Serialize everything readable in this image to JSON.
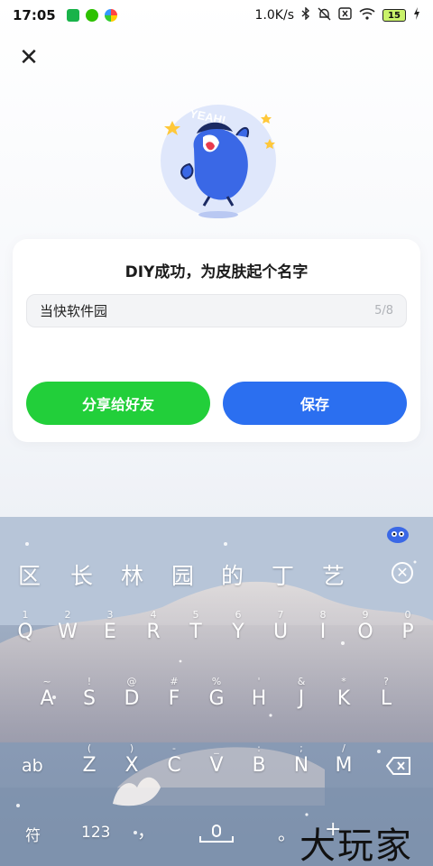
{
  "status_bar": {
    "time": "17:05",
    "net_speed": "1.0K/s",
    "battery_level": "15",
    "icons": [
      "app-icon",
      "wechat-icon",
      "browser-icon",
      "bluetooth-icon",
      "mute-icon",
      "close-box-icon",
      "wifi-icon",
      "battery-icon",
      "charging-icon"
    ]
  },
  "dialog": {
    "close_icon": "close-icon",
    "mascot_badge": "YEAH!",
    "title": "DIY成功，为皮肤起个名字",
    "name_input": {
      "value": "当快软件园",
      "counter": "5/8"
    },
    "share_label": "分享给好友",
    "save_label": "保存",
    "colors": {
      "share": "#22cf3a",
      "save": "#2b6ff0"
    }
  },
  "keyboard": {
    "candidates": [
      "区",
      "长",
      "林",
      "园",
      "的",
      "丁",
      "艺"
    ],
    "row1": [
      {
        "ch": "Q",
        "hint": "1"
      },
      {
        "ch": "W",
        "hint": "2"
      },
      {
        "ch": "E",
        "hint": "3"
      },
      {
        "ch": "R",
        "hint": "4"
      },
      {
        "ch": "T",
        "hint": "5"
      },
      {
        "ch": "Y",
        "hint": "6"
      },
      {
        "ch": "U",
        "hint": "7"
      },
      {
        "ch": "I",
        "hint": "8"
      },
      {
        "ch": "O",
        "hint": "9"
      },
      {
        "ch": "P",
        "hint": "0"
      }
    ],
    "row2": [
      {
        "ch": "A",
        "hint": "~"
      },
      {
        "ch": "S",
        "hint": "!"
      },
      {
        "ch": "D",
        "hint": "@"
      },
      {
        "ch": "F",
        "hint": "#"
      },
      {
        "ch": "G",
        "hint": "%"
      },
      {
        "ch": "H",
        "hint": "'"
      },
      {
        "ch": "J",
        "hint": "&"
      },
      {
        "ch": "K",
        "hint": "*"
      },
      {
        "ch": "L",
        "hint": "?"
      }
    ],
    "row3": [
      {
        "ch": "Z",
        "hint": "("
      },
      {
        "ch": "X",
        "hint": ")"
      },
      {
        "ch": "C",
        "hint": "-"
      },
      {
        "ch": "V",
        "hint": "_"
      },
      {
        "ch": "B",
        "hint": ":"
      },
      {
        "ch": "N",
        "hint": ";"
      },
      {
        "ch": "M",
        "hint": "/"
      }
    ],
    "shift_label": "ab",
    "symbols_label": "符",
    "numbers_label": "123",
    "comma_label": "，",
    "period_label": "。",
    "plus_label": "+"
  },
  "watermark": "大玩家"
}
